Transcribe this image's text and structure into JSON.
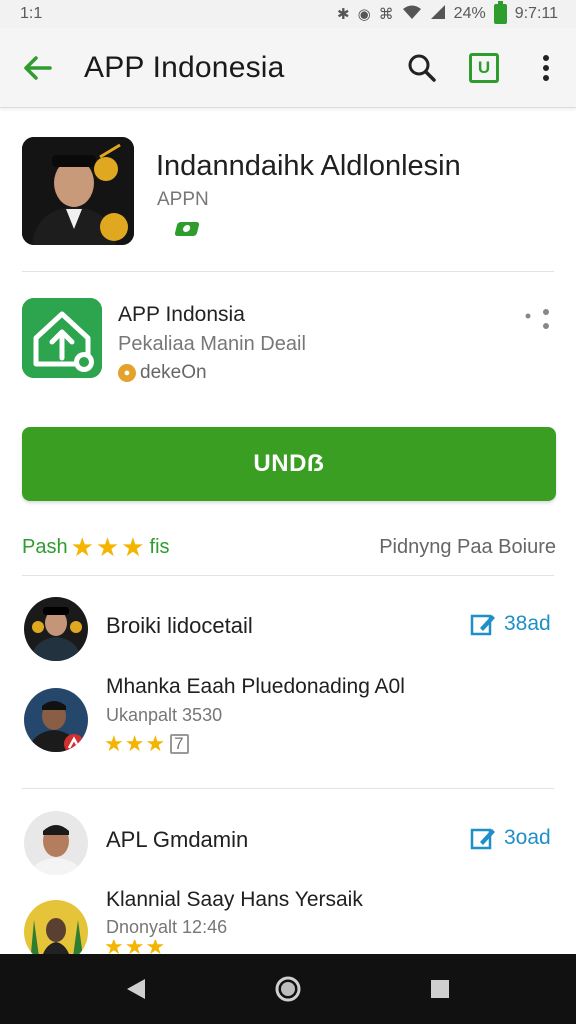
{
  "status_bar": {
    "left_text": "1:1",
    "battery_text": "24%",
    "time": "9:7:11"
  },
  "app_bar": {
    "title": "APP Indonesia",
    "icons": [
      "back-arrow-icon",
      "search-icon",
      "u-box-icon",
      "more-vert-icon"
    ]
  },
  "hero": {
    "title": "Indanndaihk Aldlonlesin",
    "subtitle": "APPN"
  },
  "app_row": {
    "name": "APP Indonsia",
    "description": "Pekaliaa Manin Deail",
    "developer": "dekeOn"
  },
  "install_button": {
    "label": "UNDẞ"
  },
  "rating_row": {
    "left_prefix": "Pash",
    "stars": "★★★",
    "left_suffix": "fis",
    "right_text": "Pidnyng Paa Boiure"
  },
  "reviews": [
    {
      "name": "Broiki lidocetail",
      "link": "38ad",
      "text": "Mhanka Eaah Pluedonading A0l",
      "meta": "Ukanpalt 3530",
      "stars": "★★★",
      "count": "7"
    },
    {
      "name": "APL Gmdamin",
      "link": "3oad",
      "text": "Klannial Saay Hans Yersaik",
      "meta": "Dnonyalt 12:46",
      "stars": "★★★"
    }
  ],
  "colors": {
    "accent_green": "#2e9d2e",
    "install_green": "#3a9e23",
    "link_blue": "#1f8fc8",
    "star_gold": "#f4b400"
  }
}
